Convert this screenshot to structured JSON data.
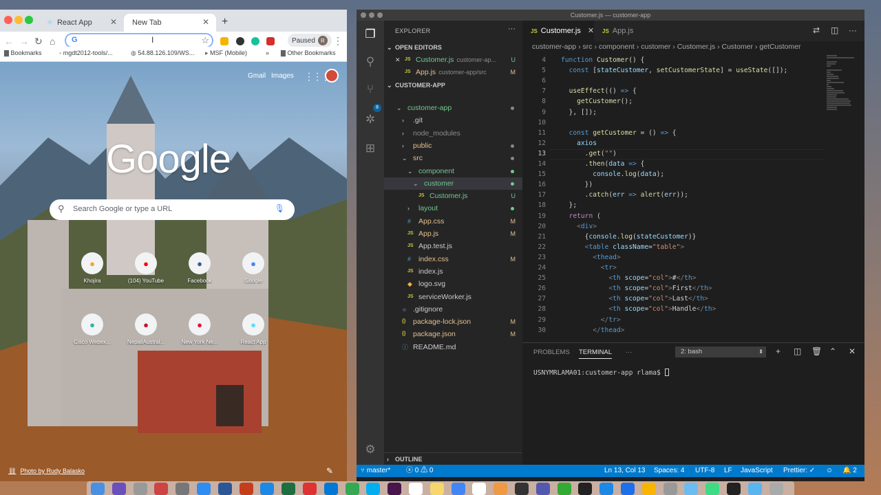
{
  "chrome": {
    "tabs": [
      {
        "label": "React App",
        "active": false
      },
      {
        "label": "New Tab",
        "active": true
      }
    ],
    "omnibox_icon": "G",
    "paused_label": "Paused",
    "profile_initial": "R",
    "bookmarks": [
      "Bookmarks",
      "mgdt2012-tools/...",
      "54.88.126.109/WS...",
      "MSF (Mobile)",
      "»",
      "Other Bookmarks"
    ],
    "ntp": {
      "links": [
        "Gmail",
        "Images"
      ],
      "logo": "Google",
      "search_placeholder": "Search Google or type a URL",
      "shortcuts": [
        {
          "label": "Khojira",
          "icon": "house-icon",
          "color": "#f5a623"
        },
        {
          "label": "(104) YouTube",
          "icon": "youtube-icon",
          "color": "#ff0000"
        },
        {
          "label": "Facebook",
          "icon": "facebook-icon",
          "color": "#3b5998"
        },
        {
          "label": "Google",
          "icon": "google-icon",
          "color": "#4285f4"
        },
        {
          "label": "Cisco Webex...",
          "icon": "webex-icon",
          "color": "#2bb7a3"
        },
        {
          "label": "NepaliAustral...",
          "icon": "flag-icon",
          "color": "#c8102e"
        },
        {
          "label": "New York Ne...",
          "icon": "flag-icon",
          "color": "#dc143c"
        },
        {
          "label": "React App",
          "icon": "react-icon",
          "color": "#61dafb"
        }
      ],
      "photo_credit": "Photo by Rudy Balasko"
    }
  },
  "vscode": {
    "window_title": "Customer.js — customer-app",
    "scm_badge": "8",
    "explorer": {
      "title": "EXPLORER",
      "open_editors_title": "OPEN EDITORS",
      "open_editors": [
        {
          "name": "Customer.js",
          "path": "customer-ap...",
          "mark": "U",
          "close": "✕"
        },
        {
          "name": "App.js",
          "path": "customer-app/src",
          "mark": "M",
          "close": ""
        }
      ],
      "project_title": "CUSTOMER-APP",
      "tree": [
        {
          "name": "customer-app",
          "indent": 0,
          "kind": "folder-open",
          "color": "#73c991",
          "dot": "#888"
        },
        {
          "name": ".git",
          "indent": 1,
          "kind": "folder",
          "color": "#ccc"
        },
        {
          "name": "node_modules",
          "indent": 1,
          "kind": "folder",
          "color": "#8c8c8c"
        },
        {
          "name": "public",
          "indent": 1,
          "kind": "folder",
          "color": "#e2c08d",
          "dot": "#888"
        },
        {
          "name": "src",
          "indent": 1,
          "kind": "folder-open",
          "color": "#e2c08d",
          "dot": "#888"
        },
        {
          "name": "component",
          "indent": 2,
          "kind": "folder-open",
          "color": "#73c991",
          "dot": "#73c991"
        },
        {
          "name": "customer",
          "indent": 3,
          "kind": "folder-open",
          "color": "#73c991",
          "dot": "#73c991",
          "sel": true
        },
        {
          "name": "Customer.js",
          "indent": 4,
          "kind": "js",
          "color": "#73c991",
          "mark": "U"
        },
        {
          "name": "layout",
          "indent": 2,
          "kind": "folder",
          "color": "#73c991",
          "dot": "#73c991"
        },
        {
          "name": "App.css",
          "indent": 2,
          "kind": "css",
          "color": "#e2c08d",
          "mark": "M"
        },
        {
          "name": "App.js",
          "indent": 2,
          "kind": "js",
          "color": "#e2c08d",
          "mark": "M"
        },
        {
          "name": "App.test.js",
          "indent": 2,
          "kind": "js",
          "color": "#ccc"
        },
        {
          "name": "index.css",
          "indent": 2,
          "kind": "css",
          "color": "#e2c08d",
          "mark": "M"
        },
        {
          "name": "index.js",
          "indent": 2,
          "kind": "js",
          "color": "#ccc"
        },
        {
          "name": "logo.svg",
          "indent": 2,
          "kind": "svg",
          "color": "#ccc"
        },
        {
          "name": "serviceWorker.js",
          "indent": 2,
          "kind": "js",
          "color": "#ccc"
        },
        {
          "name": ".gitignore",
          "indent": 1,
          "kind": "git",
          "color": "#ccc"
        },
        {
          "name": "package-lock.json",
          "indent": 1,
          "kind": "json",
          "color": "#e2c08d",
          "mark": "M"
        },
        {
          "name": "package.json",
          "indent": 1,
          "kind": "json",
          "color": "#e2c08d",
          "mark": "M"
        },
        {
          "name": "README.md",
          "indent": 1,
          "kind": "info",
          "color": "#ccc"
        }
      ],
      "outline_title": "OUTLINE"
    },
    "editor_tabs": [
      {
        "label": "Customer.js",
        "active": true
      },
      {
        "label": "App.js",
        "active": false
      }
    ],
    "breadcrumbs": [
      "customer-app",
      "src",
      "component",
      "customer",
      "Customer.js",
      "Customer",
      "getCustomer"
    ],
    "current_line": 13,
    "code_lines": [
      {
        "n": "4",
        "html": "<span class='k'>function</span> <span class='f'>Customer</span>() {"
      },
      {
        "n": "5",
        "html": "  <span class='k'>const</span> [<span class='v'>stateCustomer</span>, <span class='f'>setCustomerState</span>] = <span class='f'>useState</span>([]);"
      },
      {
        "n": "6",
        "html": ""
      },
      {
        "n": "7",
        "html": "  <span class='f'>useEffect</span>(() <span class='k'>=&gt;</span> {"
      },
      {
        "n": "8",
        "html": "    <span class='f'>getCustomer</span>();"
      },
      {
        "n": "9",
        "html": "  }, []);"
      },
      {
        "n": "10",
        "html": ""
      },
      {
        "n": "11",
        "html": "  <span class='k'>const</span> <span class='f'>getCustomer</span> = () <span class='k'>=&gt;</span> {"
      },
      {
        "n": "12",
        "html": "    <span class='v'>axios</span>"
      },
      {
        "n": "13",
        "html": "      .<span class='f'>get</span>(<span class='s'>\"\"</span>)"
      },
      {
        "n": "14",
        "html": "      .<span class='f'>then</span>(<span class='v'>data</span> <span class='k'>=&gt;</span> {"
      },
      {
        "n": "15",
        "html": "        <span class='v'>console</span>.<span class='f'>log</span>(<span class='v'>data</span>);"
      },
      {
        "n": "16",
        "html": "      })"
      },
      {
        "n": "17",
        "html": "      .<span class='f'>catch</span>(<span class='v'>err</span> <span class='k'>=&gt;</span> <span class='f'>alert</span>(<span class='v'>err</span>));"
      },
      {
        "n": "18",
        "html": "  };"
      },
      {
        "n": "19",
        "html": "  <span class='p'>return</span> ("
      },
      {
        "n": "20",
        "html": "    <span class='g'>&lt;</span><span class='k'>div</span><span class='g'>&gt;</span>"
      },
      {
        "n": "21",
        "html": "      {<span class='v'>console</span>.<span class='f'>log</span>(<span class='v'>stateCustomer</span>)}"
      },
      {
        "n": "22",
        "html": "      <span class='g'>&lt;</span><span class='k'>table</span> <span class='v'>className</span>=<span class='s'>\"table\"</span><span class='g'>&gt;</span>"
      },
      {
        "n": "23",
        "html": "        <span class='g'>&lt;</span><span class='k'>thead</span><span class='g'>&gt;</span>"
      },
      {
        "n": "24",
        "html": "          <span class='g'>&lt;</span><span class='k'>tr</span><span class='g'>&gt;</span>"
      },
      {
        "n": "25",
        "html": "            <span class='g'>&lt;</span><span class='k'>th</span> <span class='v'>scope</span>=<span class='s'>\"col\"</span><span class='g'>&gt;</span>#<span class='g'>&lt;/</span><span class='k'>th</span><span class='g'>&gt;</span>"
      },
      {
        "n": "26",
        "html": "            <span class='g'>&lt;</span><span class='k'>th</span> <span class='v'>scope</span>=<span class='s'>\"col\"</span><span class='g'>&gt;</span>First<span class='g'>&lt;/</span><span class='k'>th</span><span class='g'>&gt;</span>"
      },
      {
        "n": "27",
        "html": "            <span class='g'>&lt;</span><span class='k'>th</span> <span class='v'>scope</span>=<span class='s'>\"col\"</span><span class='g'>&gt;</span>Last<span class='g'>&lt;/</span><span class='k'>th</span><span class='g'>&gt;</span>"
      },
      {
        "n": "28",
        "html": "            <span class='g'>&lt;</span><span class='k'>th</span> <span class='v'>scope</span>=<span class='s'>\"col\"</span><span class='g'>&gt;</span>Handle<span class='g'>&lt;/</span><span class='k'>th</span><span class='g'>&gt;</span>"
      },
      {
        "n": "29",
        "html": "          <span class='g'>&lt;/</span><span class='k'>tr</span><span class='g'>&gt;</span>"
      },
      {
        "n": "30",
        "html": "        <span class='g'>&lt;/</span><span class='k'>thead</span><span class='g'>&gt;</span>"
      }
    ],
    "panel": {
      "tabs": [
        "PROBLEMS",
        "TERMINAL",
        "···"
      ],
      "active_tab": "TERMINAL",
      "shell": "2: bash",
      "prompt": "USNYMRLAMA01:customer-app rlama$ "
    },
    "status": {
      "branch": "master*",
      "errors": "0",
      "warnings": "0",
      "position": "Ln 13, Col 13",
      "spaces": "Spaces: 4",
      "encoding": "UTF-8",
      "eol": "LF",
      "language": "JavaScript",
      "formatter": "Prettier: ✓",
      "notifications": "2"
    }
  },
  "dock": {
    "icons": [
      "finder-icon",
      "siri-icon",
      "launchpad-icon",
      "tool-icon",
      "settings-icon",
      "appstore-icon",
      "word-icon",
      "powerpoint-icon",
      "safari-icon",
      "excel-icon",
      "screenshot-icon",
      "outlook-icon",
      "chrome-icon",
      "skype-icon",
      "slack-icon",
      "calendar-icon",
      "notes-icon",
      "chrome-icon",
      "calendar-icon",
      "photos-icon",
      "misc-icon",
      "teams-icon",
      "facetime-icon",
      "terminal-icon",
      "safari-icon",
      "vscode-icon",
      "sketch-icon",
      "misc-icon",
      "preview-icon",
      "android-icon",
      "github-icon",
      "folder-icon",
      "trash-icon"
    ],
    "colors": [
      "#4a90e2",
      "#6b4fbb",
      "#999",
      "#c44",
      "#777",
      "#2f8cf0",
      "#2b5797",
      "#c43e1c",
      "#1e88e5",
      "#1d6f42",
      "#d33",
      "#0078d4",
      "#34a853",
      "#00aff0",
      "#4a154b",
      "#fff",
      "#f5d76e",
      "#4285f4",
      "#fff",
      "#e94",
      "#333",
      "#5558af",
      "#3a3",
      "#222",
      "#1e88e5",
      "#1f6feb",
      "#f7b500",
      "#999",
      "#6bbcf0",
      "#3ddc84",
      "#222",
      "#5ab4f0",
      "#aaa"
    ]
  }
}
